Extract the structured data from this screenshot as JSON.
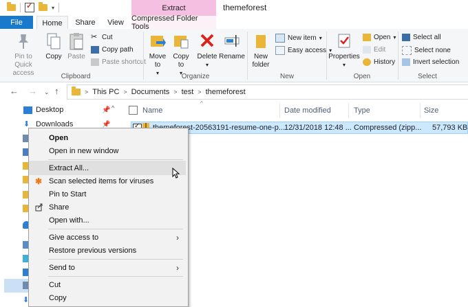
{
  "window": {
    "title": "themeforest"
  },
  "ribbon_context": {
    "label": "Extract",
    "tab": "Compressed Folder Tools"
  },
  "tabs": {
    "file": "File",
    "home": "Home",
    "share": "Share",
    "view": "View"
  },
  "ribbon": {
    "clipboard": {
      "label": "Clipboard",
      "pin": "Pin to Quick access",
      "copy": "Copy",
      "paste": "Paste",
      "cut": "Cut",
      "copy_path": "Copy path",
      "paste_shortcut": "Paste shortcut"
    },
    "organize": {
      "label": "Organize",
      "move_to": "Move to",
      "copy_to": "Copy to",
      "delete": "Delete",
      "rename": "Rename"
    },
    "new": {
      "label": "New",
      "new_folder": "New folder",
      "new_item": "New item",
      "easy_access": "Easy access"
    },
    "open": {
      "label": "Open",
      "properties": "Properties",
      "open": "Open",
      "edit": "Edit",
      "history": "History"
    },
    "select": {
      "label": "Select",
      "select_all": "Select all",
      "select_none": "Select none",
      "invert": "Invert selection"
    }
  },
  "address": {
    "crumbs": [
      "This PC",
      "Documents",
      "test",
      "themeforest"
    ]
  },
  "nav": {
    "items": [
      "Desktop",
      "Downloads"
    ]
  },
  "columns": {
    "name": "Name",
    "date": "Date modified",
    "type": "Type",
    "size": "Size"
  },
  "files": [
    {
      "name": "themeforest-20563191-resume-one-p...",
      "date": "12/31/2018 12:48 ...",
      "type": "Compressed (zipp...",
      "size": "57,793 KB"
    }
  ],
  "context_menu": {
    "open": "Open",
    "open_new_window": "Open in new window",
    "extract_all": "Extract All...",
    "scan": "Scan selected items for viruses",
    "pin_start": "Pin to Start",
    "share": "Share",
    "open_with": "Open with...",
    "give_access": "Give access to",
    "restore_versions": "Restore previous versions",
    "send_to": "Send to",
    "cut": "Cut",
    "copy": "Copy"
  },
  "colors": {
    "accent": "#1979ca",
    "context_tab": "#f5bfe1",
    "selection": "#cce8ff"
  }
}
